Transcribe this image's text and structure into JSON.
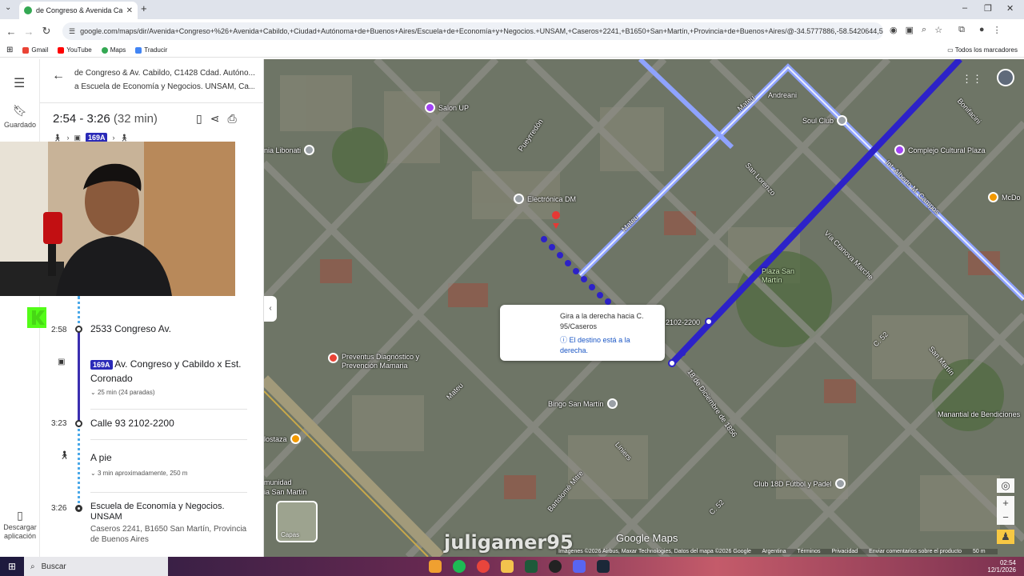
{
  "browser": {
    "tab_title": "de Congreso & Avenida Cabildo",
    "url": "google.com/maps/dir/Avenida+Congreso+%26+Avenida+Cabildo,+Ciudad+Autónoma+de+Buenos+Aires/Escuela+de+Economía+y+Negocios.+UNSAM,+Caseros+2241,+B1650+San+Martín,+Provincia+de+Buenos+Aires/@-34.5777886,-58.5420644,518m/a...",
    "bookmarks": [
      {
        "label": "Gmail",
        "color": "#ea4335"
      },
      {
        "label": "YouTube",
        "color": "#ff0000"
      },
      {
        "label": "Maps",
        "color": "#34a853"
      },
      {
        "label": "Traducir",
        "color": "#4285f4"
      }
    ],
    "bookmarks_right": "Todos los marcadores"
  },
  "rail": {
    "saved_label": "Guardado",
    "download_label": "Descargar aplicación"
  },
  "panel": {
    "from": "de Congreso & Av. Cabildo, C1428 Cdad. Autóno...",
    "to": "a Escuela de Economía y Negocios. UNSAM, Ca...",
    "time_range": "2:54 - 3:26",
    "duration": "(32 min)",
    "bus_badge": "169A",
    "steps": {
      "s1_time": "2:58",
      "s1_title": "2533 Congreso Av.",
      "bus_badge": "169A",
      "bus_title": "Av. Congreso y Cabildo x Est. Coronado",
      "bus_sub": "25 min (24 paradas)",
      "s2_time": "3:23",
      "s2_title": "Calle 93 2102-2200",
      "walk_title": "A pie",
      "walk_sub": "3 min aproximadamente, 250 m",
      "s3_time": "3:26",
      "s3_title": "Escuela de Economía y Negocios. UNSAM",
      "s3_sub": "Caseros 2241, B1650 San Martín, Provincia de Buenos Aires"
    }
  },
  "map": {
    "popup_title": "Gira a la derecha hacia C. 95/Caseros",
    "popup_note": "El destino está a la derecha.",
    "pois": [
      {
        "name": "Salon UP",
        "color": "#a142f4"
      },
      {
        "name": "Soul Club",
        "color": "#9aa0a6"
      },
      {
        "name": "Complejo Cultural Plaza",
        "color": "#a142f4"
      },
      {
        "name": "Electrónica DM",
        "color": "#9aa0a6"
      },
      {
        "name": "Preventus Diagnóstico y Prevención Mamaria",
        "color": "#ea4335"
      },
      {
        "name": "Bingo San Martín",
        "color": "#9aa0a6"
      },
      {
        "name": "Club 18D Fútbol y Padel",
        "color": "#9aa0a6"
      },
      {
        "name": "McDo",
        "color": "#f29900"
      },
      {
        "name": "nia Libonati",
        "color": "#9aa0a6"
      },
      {
        "name": "lostaza",
        "color": "#f29900"
      }
    ],
    "streets": [
      "Mateu",
      "Andreani",
      "Pueyrredón",
      "San Lorenzo",
      "Bonifacini",
      "Int. Alberto M. Campos",
      "Plaza San Martín",
      "Vía Ctanova Marche",
      "C. 52",
      "San Martín",
      "Manantial de Bendiciones",
      "18 de Diciembre de 1856",
      "Liniers",
      "Bartolomé Mitre",
      "munidad",
      "ia San Martín",
      "2102-2200"
    ],
    "layers_label": "Capas",
    "brand": "Google Maps",
    "watermark": "juligamer95",
    "attribution": [
      "Imágenes ©2026 Airbus, Maxar Technologies, Datos del mapa ©2026 Google",
      "Argentina",
      "Términos",
      "Privacidad",
      "Enviar comentarios sobre el producto",
      "50 m"
    ]
  },
  "taskbar": {
    "search_label": "Buscar",
    "clock_time": "02:54",
    "clock_date": "12/1/2026"
  }
}
